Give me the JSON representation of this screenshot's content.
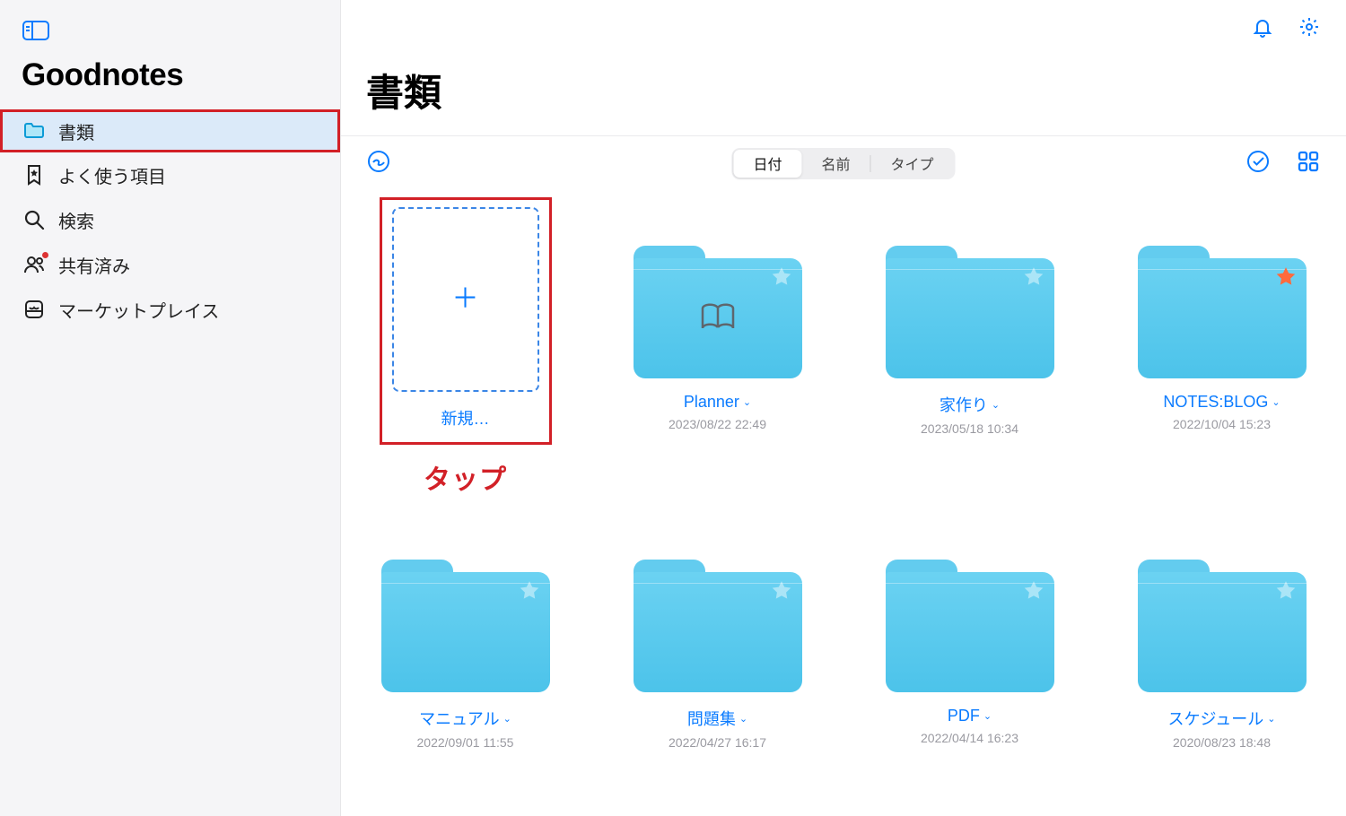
{
  "app_title": "Goodnotes",
  "page_title": "書類",
  "sidebar": {
    "items": [
      {
        "label": "書類",
        "icon": "folder"
      },
      {
        "label": "よく使う項目",
        "icon": "bookmark"
      },
      {
        "label": "検索",
        "icon": "search"
      },
      {
        "label": "共有済み",
        "icon": "people"
      },
      {
        "label": "マーケットプレイス",
        "icon": "marketplace"
      }
    ]
  },
  "segmented": {
    "date": "日付",
    "name": "名前",
    "type": "タイプ"
  },
  "new_item": {
    "label": "新規…",
    "annotation": "タップ"
  },
  "folders": [
    {
      "name": "Planner",
      "date": "2023/08/22 22:49",
      "starred": false,
      "has_book": true
    },
    {
      "name": "家作り",
      "date": "2023/05/18 10:34",
      "starred": false,
      "has_book": false
    },
    {
      "name": "NOTES:BLOG",
      "date": "2022/10/04 15:23",
      "starred": true,
      "has_book": false
    },
    {
      "name": "マニュアル",
      "date": "2022/09/01 11:55",
      "starred": false,
      "has_book": false
    },
    {
      "name": "問題集",
      "date": "2022/04/27 16:17",
      "starred": false,
      "has_book": false
    },
    {
      "name": "PDF",
      "date": "2022/04/14 16:23",
      "starred": false,
      "has_book": false
    },
    {
      "name": "スケジュール",
      "date": "2020/08/23 18:48",
      "starred": false,
      "has_book": false
    }
  ],
  "colors": {
    "accent": "#0a7bff",
    "annotation": "#d22027",
    "folder": "#5cc9ee"
  }
}
